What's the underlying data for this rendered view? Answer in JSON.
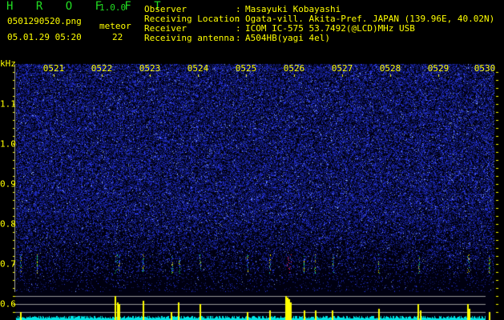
{
  "header": {
    "app_name": "H R O F F T",
    "version": "1.0.0",
    "filename": "0501290520.png",
    "datetime": "05.01.29 05:20",
    "meteor_label": "meteor",
    "meteor_count": "22",
    "fields": [
      {
        "label": "Observer",
        "value": "Masayuki Kobayashi"
      },
      {
        "label": "Receiving Location",
        "value": "Ogata-vill. Akita-Pref. JAPAN (139.96E, 40.02N)"
      },
      {
        "label": "Receiver",
        "value": "ICOM IC-575 53.7492(@LCD)MHz USB"
      },
      {
        "label": "Receiving antenna",
        "value": "A504HB(yagi 4el)"
      }
    ]
  },
  "spectrogram": {
    "y_unit": "kHz",
    "y_ticks": [
      "1.1",
      "1.0",
      "0.9",
      "0.8",
      "0.7",
      "0.6"
    ],
    "time_ticks": [
      "0521",
      "0522",
      "0523",
      "0524",
      "0525",
      "0526",
      "0527",
      "0528",
      "0529",
      "0530"
    ],
    "colors": {
      "noise": "#2233dd",
      "text": "#ffff00",
      "meteor_strong": "#ff2266",
      "bars_high": "#ffff00",
      "bars_low": "#00e5e5"
    }
  }
}
